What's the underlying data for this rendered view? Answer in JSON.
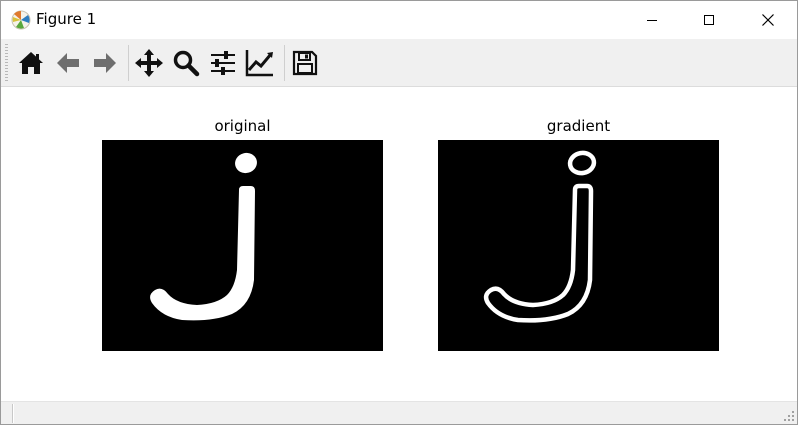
{
  "window": {
    "title": "Figure 1",
    "app_icon": "matplotlib-icon",
    "controls": {
      "minimize_icon": "minimize-icon",
      "maximize_icon": "maximize-icon",
      "close_icon": "close-icon"
    }
  },
  "toolbar": {
    "tools": [
      {
        "name": "home",
        "icon": "home-icon"
      },
      {
        "name": "back",
        "icon": "back-arrow-icon"
      },
      {
        "name": "forward",
        "icon": "forward-arrow-icon"
      },
      {
        "name": "pan",
        "icon": "pan-icon"
      },
      {
        "name": "zoom",
        "icon": "zoom-icon"
      },
      {
        "name": "configure-subplots",
        "icon": "sliders-icon"
      },
      {
        "name": "edit-axis",
        "icon": "line-chart-icon"
      },
      {
        "name": "save",
        "icon": "save-icon"
      }
    ]
  },
  "figure": {
    "subplots": [
      {
        "title": "original",
        "image": "letter-j-filled"
      },
      {
        "title": "gradient",
        "image": "letter-j-outline"
      }
    ]
  },
  "colors": {
    "toolbar_bg": "#f0f0f0",
    "image_bg": "#000000",
    "stroke": "#ffffff",
    "arrow_gray": "#6e6e6e"
  }
}
